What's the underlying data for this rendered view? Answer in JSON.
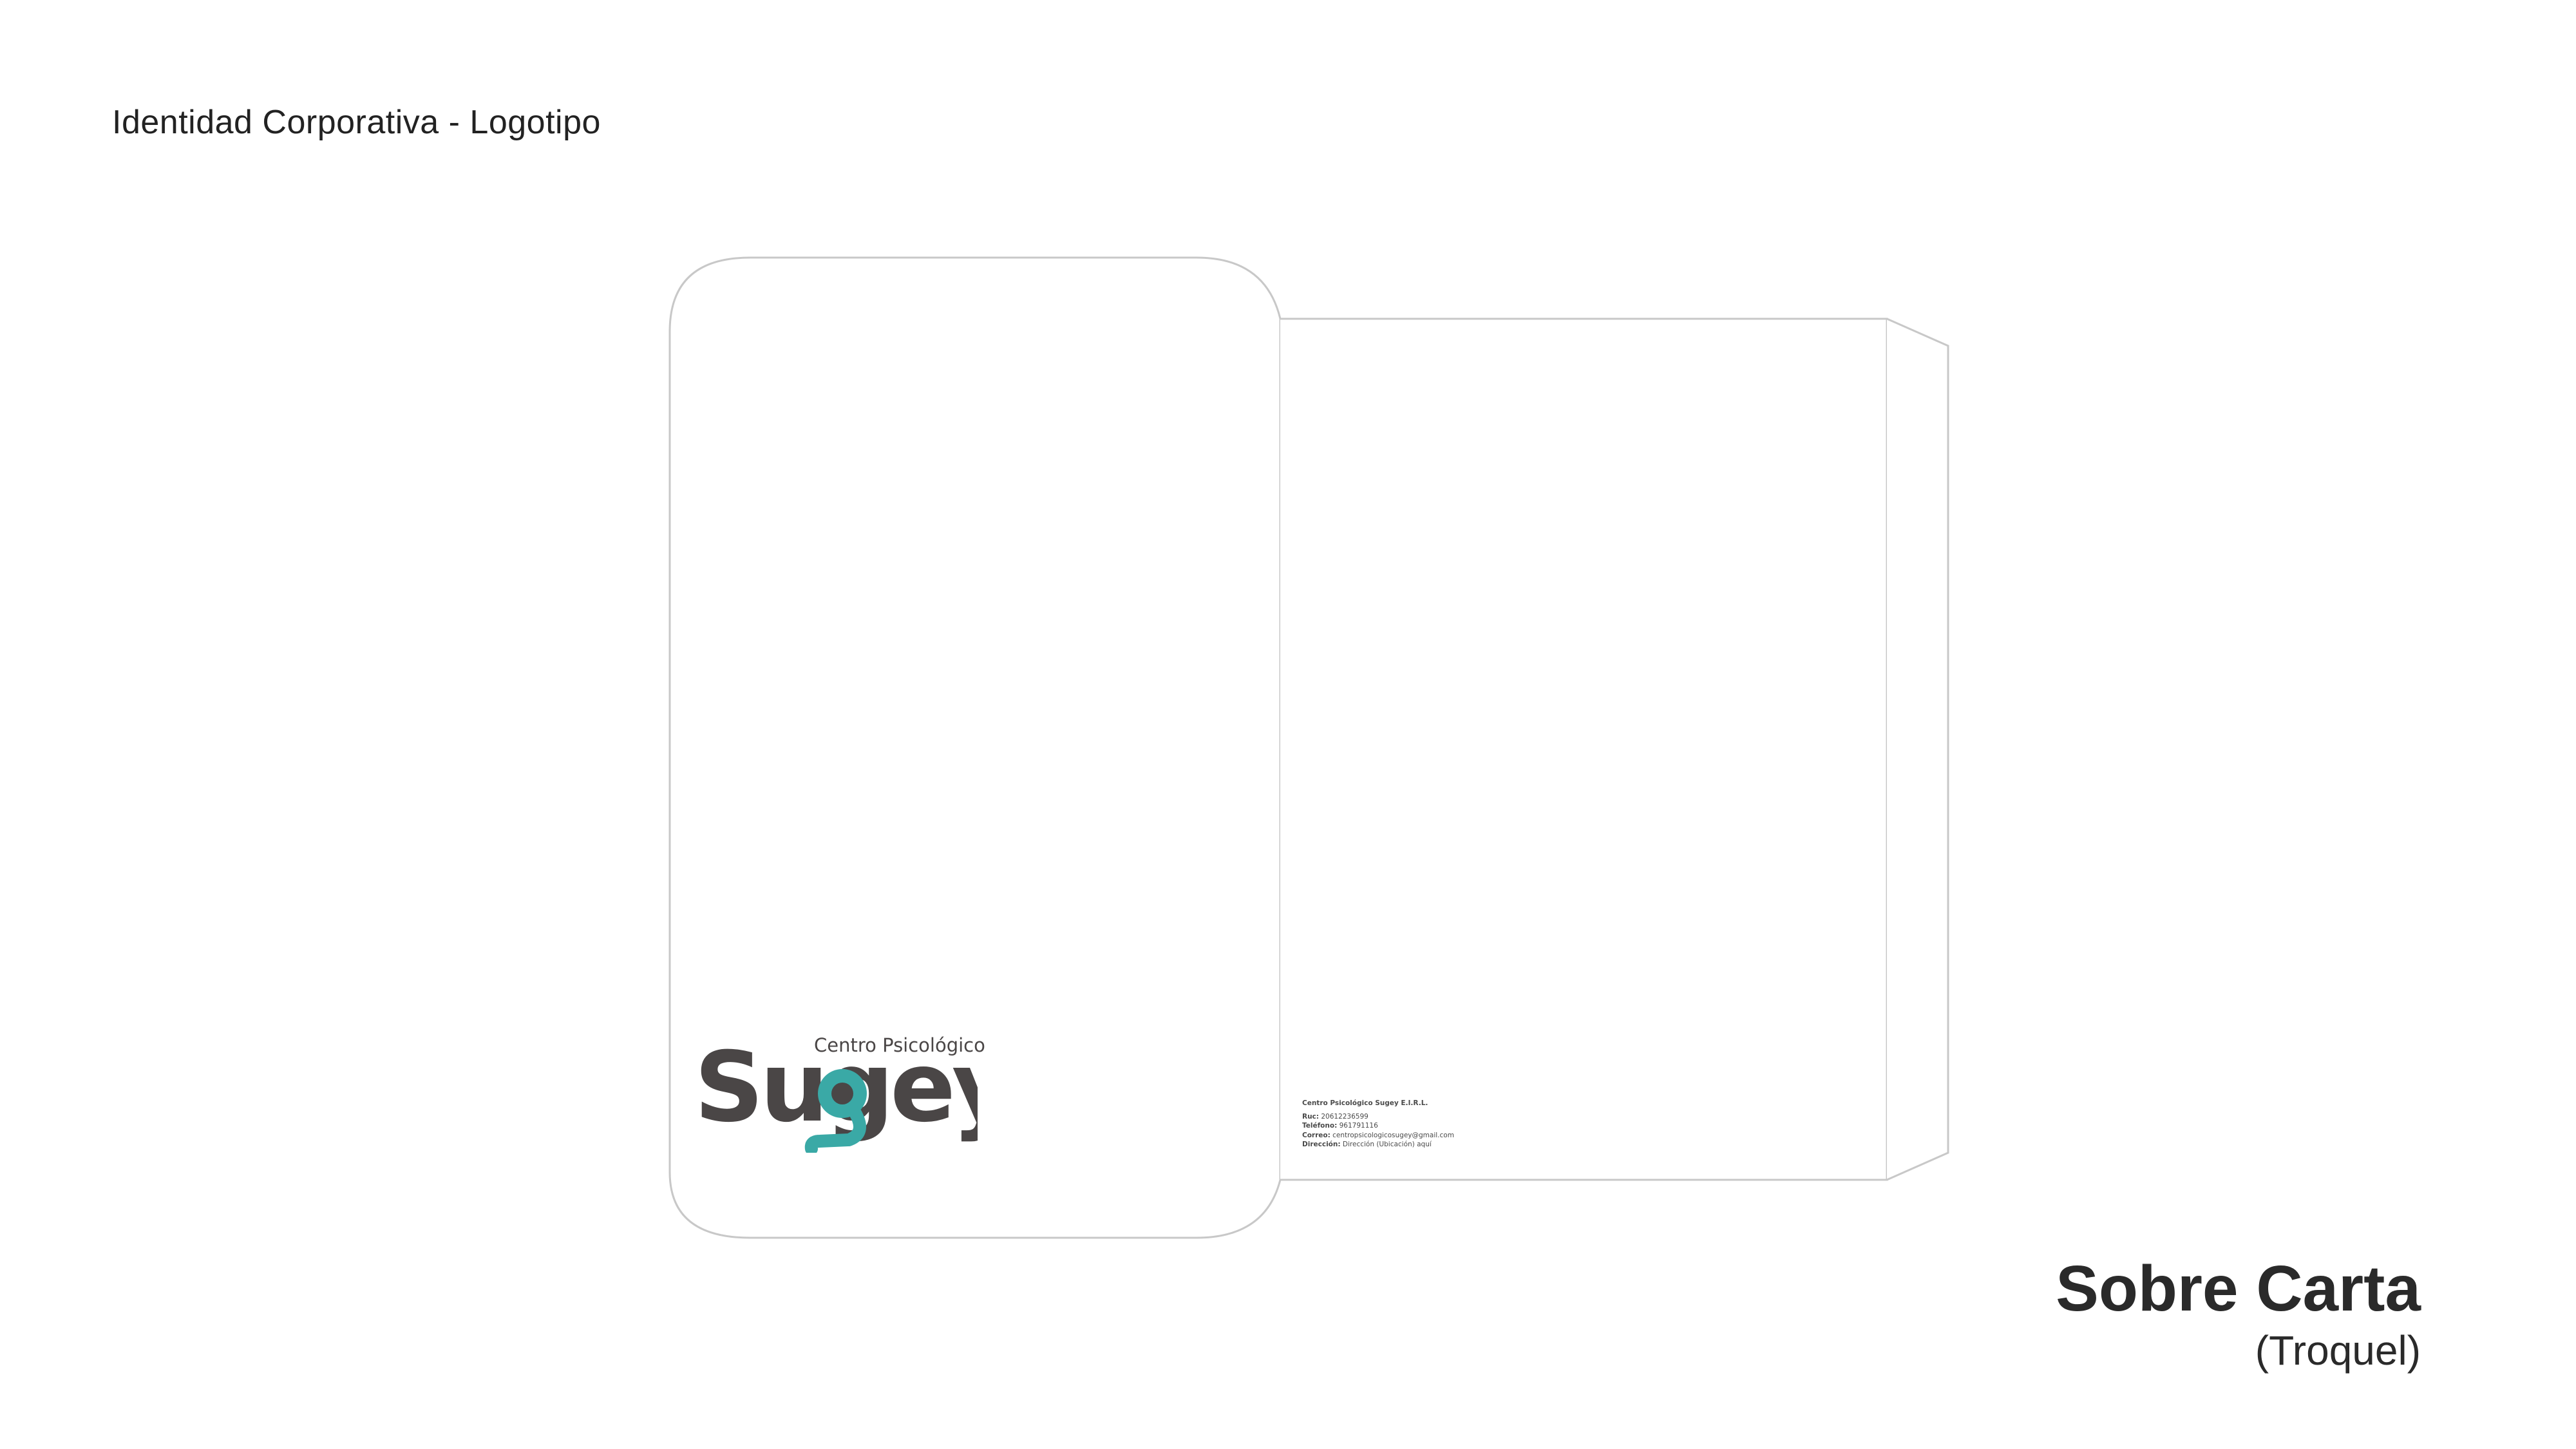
{
  "header": {
    "title": "Identidad Corporativa - Logotipo"
  },
  "logo": {
    "tagline": "Centro Psicológico",
    "wordmark": "Sugey",
    "wordmark_color": "#4a4646",
    "accent_color": "#3aa9a6",
    "icon": "sugey-logo-icon"
  },
  "sender": {
    "company": "Centro Psicológico Sugey E.I.R.L.",
    "lines": [
      {
        "label": "Ruc:",
        "value": "20612236599"
      },
      {
        "label": "Teléfono:",
        "value": "961791116"
      },
      {
        "label": "Correo:",
        "value": "centropsicologicosugey@gmail.com"
      },
      {
        "label": "Dirección:",
        "value": "Dirección (Ubicación) aquí"
      }
    ]
  },
  "product": {
    "title": "Sobre Carta",
    "subtitle": "(Troquel)"
  },
  "colors": {
    "text": "#222222",
    "dieline": "#c8c8c8"
  }
}
